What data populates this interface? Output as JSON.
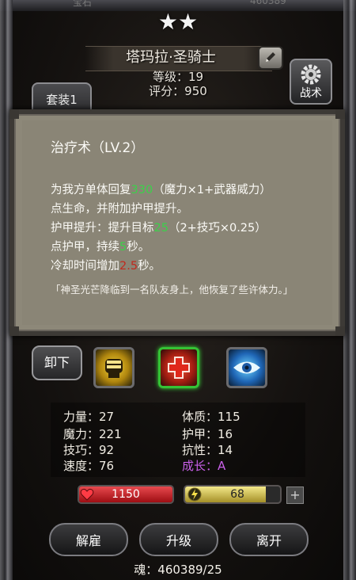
{
  "header": {
    "faint_left": "宝石",
    "faint_right": "460389"
  },
  "hero": {
    "stars": "★★",
    "name": "塔玛拉·圣骑士",
    "level_text": "等级：19",
    "score_text": "评分：950"
  },
  "tabs": {
    "suit_label": "套装1"
  },
  "tactics": {
    "label": "战术",
    "icon": "gear-icon"
  },
  "tooltip": {
    "title": "治疗术（LV.2）",
    "line1_a": "为我方单体回复",
    "line1_val": "330",
    "line1_b": "（魔力×1+武器威力）",
    "line2": "点生命，并附加护甲提升。",
    "line3_a": "护甲提升：提升目标",
    "line3_val": "25",
    "line3_b": "（2+技巧×0.25）",
    "line4_a": "点护甲，持续",
    "line4_val": "5",
    "line4_b": "秒。",
    "line5_a": "冷却时间增加",
    "line5_val": "2.5",
    "line5_b": "秒。",
    "flavor": "「神圣光芒降临到一名队友身上，他恢复了些许体力。」",
    "colors": {
      "green": "#3bd14a",
      "red": "#c02a1e"
    }
  },
  "skills": {
    "unequip_label": "卸下",
    "slots": [
      {
        "icon": "fist-icon",
        "selected": false
      },
      {
        "icon": "red-cross-icon",
        "selected": true
      },
      {
        "icon": "eye-icon",
        "selected": false
      }
    ]
  },
  "stats": {
    "strength": "力量：27",
    "magic": "魔力：221",
    "skill": "技巧：92",
    "speed": "速度：76",
    "constitution": "体质：115",
    "armor": "护甲：16",
    "resistance": "抗性：14",
    "growth": "成长：A"
  },
  "bars": {
    "hp_value": "1150",
    "hp_fill": 1.0,
    "mp_value": "68",
    "mp_fill": 0.85,
    "plus": "+"
  },
  "buttons": {
    "dismiss": "解雇",
    "upgrade": "升级",
    "leave": "离开"
  },
  "footer": {
    "soul_text": "魂：460389/25"
  }
}
